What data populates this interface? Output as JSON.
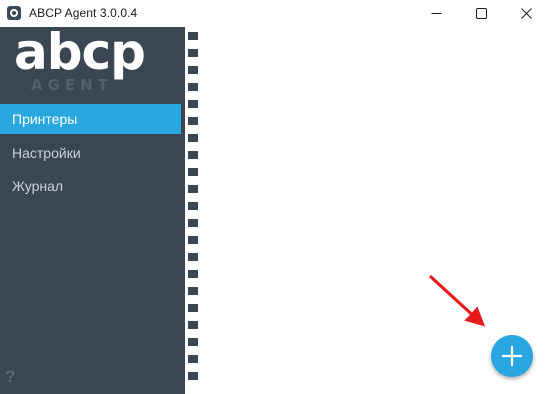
{
  "window": {
    "title": "ABCP Agent 3.0.0.4"
  },
  "logo": {
    "main": "abcp",
    "sub": "AGENT"
  },
  "sidebar": {
    "items": [
      {
        "label": "Принтеры",
        "active": true
      },
      {
        "label": "Настройки",
        "active": false
      },
      {
        "label": "Журнал",
        "active": false
      }
    ],
    "help": "?"
  },
  "icons": {
    "app": "abcp-app-icon",
    "minimize": "minimize-icon",
    "maximize": "maximize-icon",
    "close": "close-icon",
    "add": "plus-icon",
    "annotation": "red-arrow-icon"
  },
  "colors": {
    "sidebar_bg": "#3a4651",
    "accent": "#29a7e1",
    "arrow": "#e8191b"
  }
}
